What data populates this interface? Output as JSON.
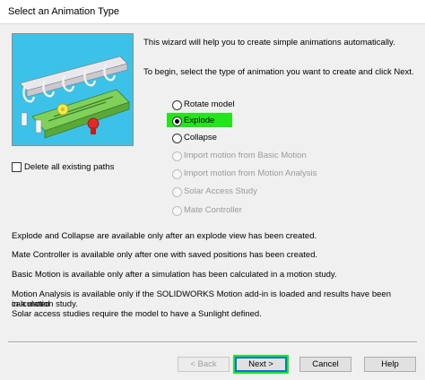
{
  "window": {
    "title": "Select an Animation Type"
  },
  "intro": {
    "line1": "This wizard will help you to create simple animations automatically.",
    "line2": "To begin, select the type of animation you want to create and click  Next."
  },
  "options": [
    {
      "label": "Rotate model",
      "selected": false,
      "enabled": true
    },
    {
      "label": "Explode",
      "selected": true,
      "enabled": true
    },
    {
      "label": "Collapse",
      "selected": false,
      "enabled": true
    },
    {
      "label": "Import motion from Basic Motion",
      "selected": false,
      "enabled": false
    },
    {
      "label": "Import motion from Motion Analysis",
      "selected": false,
      "enabled": false
    },
    {
      "label": "Solar Access Study",
      "selected": false,
      "enabled": false
    },
    {
      "label": "Mate Controller",
      "selected": false,
      "enabled": false
    }
  ],
  "delete_paths": {
    "label": "Delete all existing paths",
    "checked": false
  },
  "notes": {
    "n1": "Explode and Collapse are available only after an explode view has been created.",
    "n2": "Mate Controller is available only after one with saved positions has been created.",
    "n3": "Basic Motion is available only after a simulation has been calculated in a motion study.",
    "n4a": "Motion Analysis is available only if the SOLIDWORKS Motion add-in is loaded and results have been calculated",
    "n4b": "in a motion study.",
    "n5": "Solar access studies require the model to have a Sunlight defined."
  },
  "buttons": {
    "back": "< Back",
    "next": "Next >",
    "cancel": "Cancel",
    "help": "Help"
  },
  "colors": {
    "highlight": "#22e61a",
    "image_background": "#3cc2e8",
    "model_body": "#7fd15a"
  }
}
